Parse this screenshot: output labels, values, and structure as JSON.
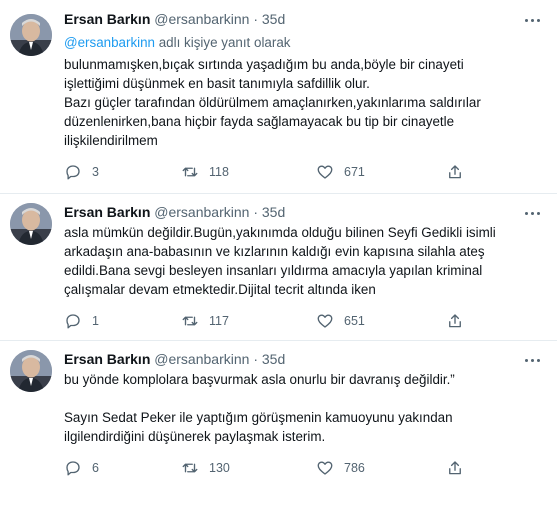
{
  "tweets": [
    {
      "author": {
        "name": "Ersan Barkın",
        "handle": "@ersanbarkinn",
        "time": "35d"
      },
      "reply_prefix": "",
      "reply_handle": "@ersanbarkinn",
      "reply_suffix": " adlı kişiye yanıt olarak",
      "lines": [
        "bulunmamışken,bıçak sırtında yaşadığım bu anda,böyle bir cinayeti",
        "işlettiğimi düşünmek en basit tanımıyla safdillik olur.",
        "Bazı güçler tarafından öldürülmem amaçlanırken,yakınlarıma saldırılar",
        "düzenlenirken,bana hiçbir fayda sağlamayacak bu tip bir cinayetle",
        "ilişkilendirilmem"
      ],
      "stats": {
        "replies": "3",
        "retweets": "118",
        "likes": "671"
      }
    },
    {
      "author": {
        "name": "Ersan Barkın",
        "handle": "@ersanbarkinn",
        "time": "35d"
      },
      "lines": [
        "asla mümkün değildir.Bugün,yakınımda olduğu bilinen Seyfi Gedikli isimli",
        "arkadaşın ana-babasının ve kızlarının kaldığı evin kapısına silahla ateş",
        "edildi.Bana sevgi besleyen insanları yıldırma amacıyla yapılan kriminal",
        "çalışmalar devam etmektedir.Dijital tecrit altında iken"
      ],
      "stats": {
        "replies": "1",
        "retweets": "117",
        "likes": "651"
      }
    },
    {
      "author": {
        "name": "Ersan Barkın",
        "handle": "@ersanbarkinn",
        "time": "35d"
      },
      "lines": [
        "bu yönde komplolara başvurmak asla onurlu bir davranış değildir.”",
        "",
        "Sayın Sedat Peker ile yaptığım görüşmenin kamuoyunu yakından",
        "ilgilendirdiğini düşünerek paylaşmak isterim."
      ],
      "stats": {
        "replies": "6",
        "retweets": "130",
        "likes": "786"
      }
    }
  ],
  "icons": [
    "reply-icon",
    "retweet-icon",
    "like-icon",
    "share-icon",
    "more-icon"
  ],
  "colors": {
    "link": "#1d9bf0",
    "muted": "#536471",
    "text": "#0f1419",
    "divider": "#e6ecf0"
  }
}
